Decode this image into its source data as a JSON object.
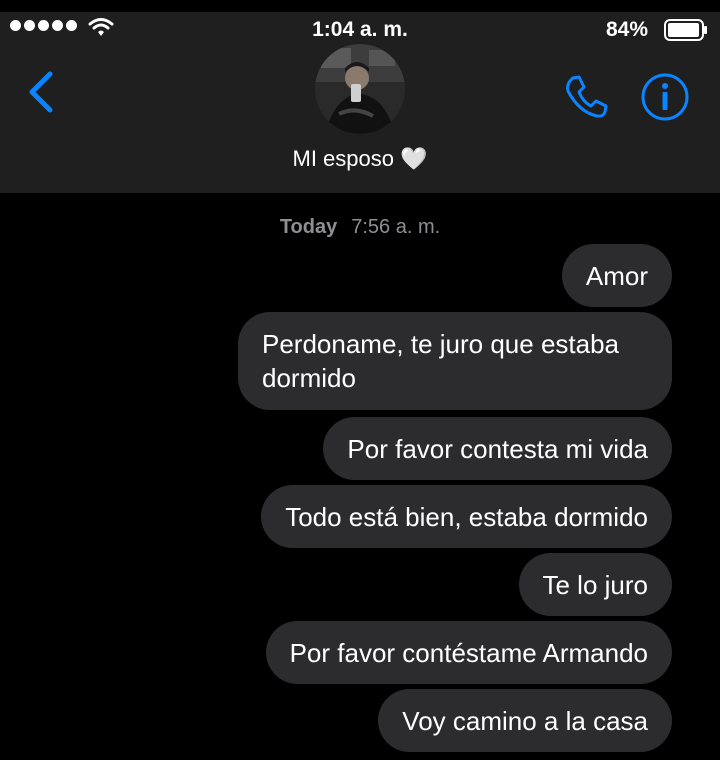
{
  "status_bar": {
    "time": "1:04 a. m.",
    "battery": "84%"
  },
  "header": {
    "contact_name": "MI esposo 🤍"
  },
  "conversation": {
    "date_label": "Today",
    "time_label": "7:56 a. m.",
    "messages": [
      "Amor",
      "Perdoname, te juro que estaba dormido",
      "Por favor contesta mi vida",
      "Todo está bien, estaba dormido",
      "Te lo juro",
      "Por favor contéstame Armando",
      "Voy camino a la casa"
    ]
  },
  "colors": {
    "accent": "#0a84ff",
    "header_bg": "#1f1f1f",
    "bubble_bg": "#2c2c2e",
    "timestamp": "#8e8e93"
  },
  "icons": [
    "signal-icon",
    "wifi-icon",
    "battery-icon",
    "back-chevron-icon",
    "phone-icon",
    "info-icon"
  ]
}
